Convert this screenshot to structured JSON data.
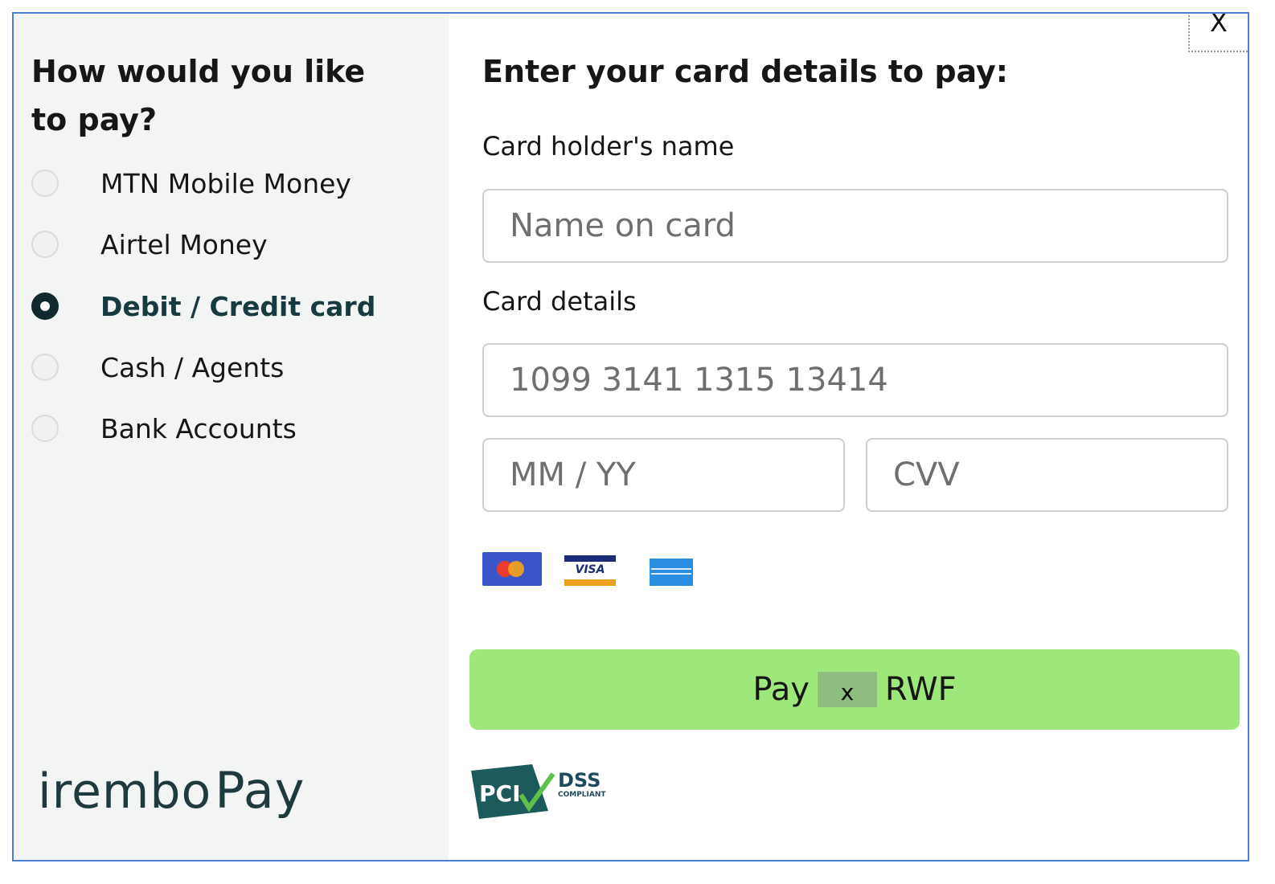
{
  "left": {
    "title": "How would you like to pay?",
    "options": [
      {
        "label": "MTN Mobile Money",
        "selected": false
      },
      {
        "label": "Airtel Money",
        "selected": false
      },
      {
        "label": "Debit / Credit card",
        "selected": true
      },
      {
        "label": "Cash / Agents",
        "selected": false
      },
      {
        "label": "Bank Accounts",
        "selected": false
      }
    ],
    "logo": {
      "brand": "irembo",
      "suffix": "Pay"
    }
  },
  "right": {
    "title": "Enter your card details to pay:",
    "card_holder_label": "Card holder's name",
    "name_placeholder": "Name on card",
    "card_details_label": "Card details",
    "card_number_placeholder": "1099 3141 1315 13414",
    "expiry_placeholder": "MM / YY",
    "cvv_placeholder": "CVV",
    "card_logos": [
      "mastercard",
      "visa",
      "american-express"
    ],
    "visa_text": "VISA",
    "pay_button": {
      "prefix": "Pay",
      "amount": "x",
      "currency": "RWF"
    },
    "pci": {
      "text": "PCI",
      "dss": "DSS",
      "compliant": "COMPLIANT"
    }
  },
  "close_label": "X",
  "colors": {
    "accent_green": "#9ee87b",
    "frame_blue": "#4a7fd6",
    "dark_teal": "#0f2a2e"
  }
}
